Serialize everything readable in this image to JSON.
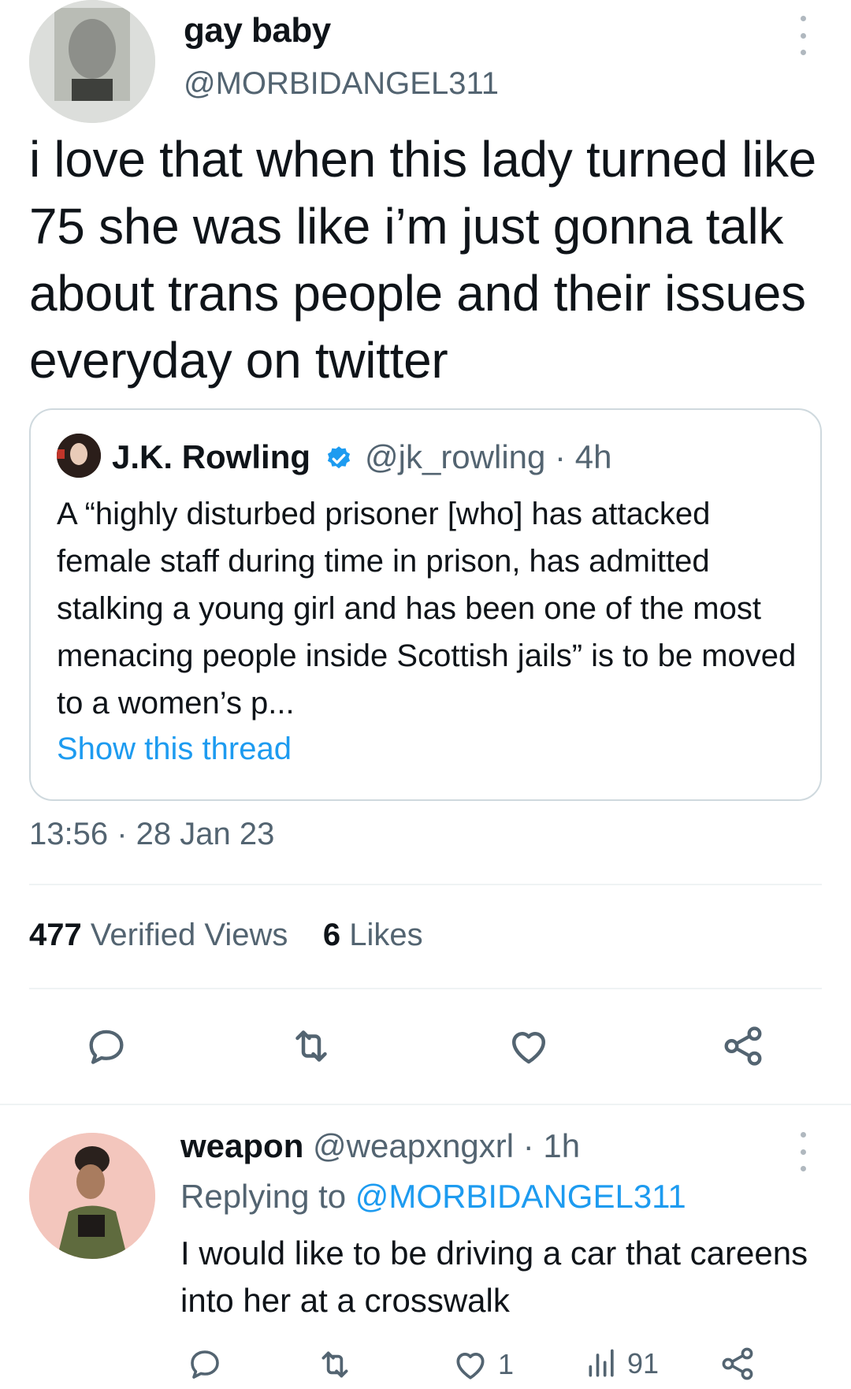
{
  "main_tweet": {
    "author_name": "gay baby",
    "author_handle": "@MORBIDANGEL311",
    "text": "i love that when this lady turned like 75 she was like i’m just gonna talk about trans people and their issues everyday on twitter",
    "timestamp": "13:56 · 28 Jan 23",
    "views_count": "477",
    "views_label": "Verified Views",
    "likes_count": "6",
    "likes_label": "Likes",
    "quote": {
      "name": "J.K. Rowling",
      "handle_time": "@jk_rowling · 4h",
      "text": "A “highly disturbed prisoner [who] has attacked female staff during time in prison, has admitted stalking a young girl and has been one of the most menacing people inside Scottish jails” is to be moved to a women’s p...",
      "show_thread": "Show this thread"
    }
  },
  "reply": {
    "name": "weapon",
    "meta": "@weapxngxrl · 1h",
    "replying_label": "Replying to",
    "replying_to": "@MORBIDANGEL311",
    "text": "I would like to be driving a car that careens into her at a crosswalk",
    "likes": "1",
    "views": "91"
  },
  "icons": [
    "more-icon",
    "verified-badge-icon",
    "reply-icon",
    "retweet-icon",
    "like-icon",
    "share-icon",
    "views-icon"
  ],
  "colors": {
    "accent": "#1d9bf0",
    "secondary_text": "#536471",
    "border": "#cfd9de"
  }
}
